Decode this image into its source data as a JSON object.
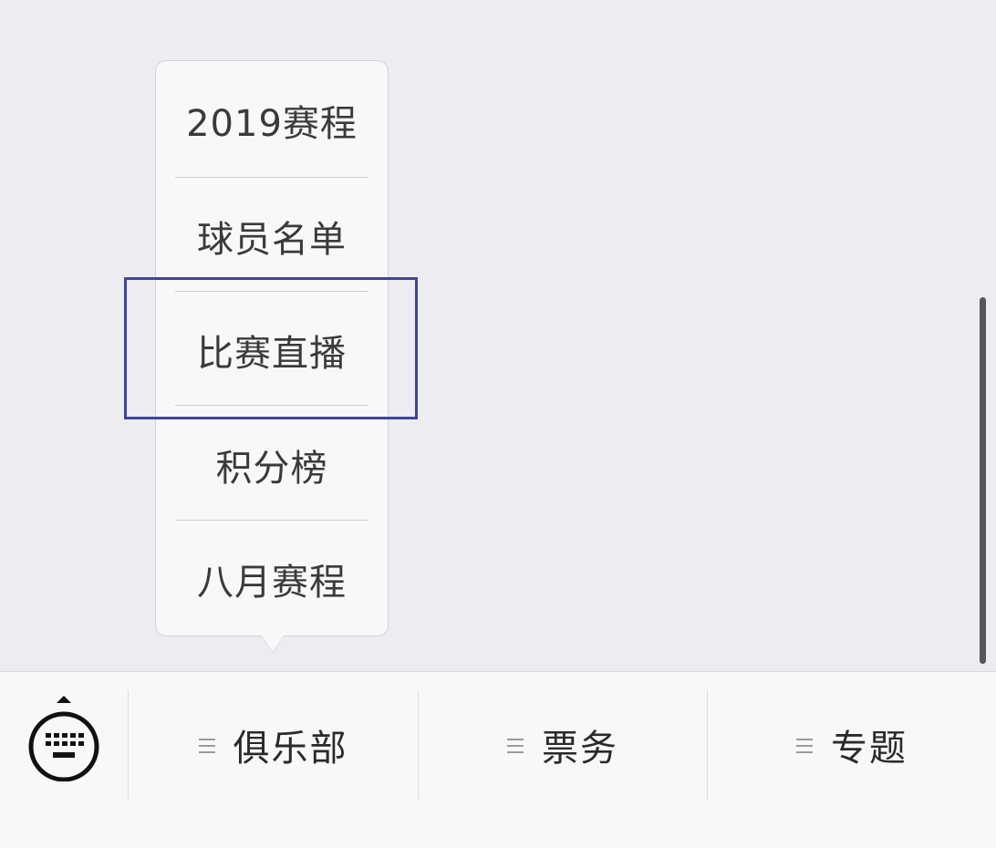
{
  "popup_menu": {
    "items": [
      {
        "label": "2019赛程"
      },
      {
        "label": "球员名单"
      },
      {
        "label": "比赛直播"
      },
      {
        "label": "积分榜"
      },
      {
        "label": "八月赛程"
      }
    ],
    "highlighted_item": "比赛直播"
  },
  "bottom_bar": {
    "keyboard_icon": "keyboard-icon",
    "tabs": [
      {
        "label": "俱乐部",
        "icon": "menu-icon"
      },
      {
        "label": "票务",
        "icon": "menu-icon"
      },
      {
        "label": "专题",
        "icon": "menu-icon"
      }
    ]
  },
  "colors": {
    "background": "#edecf0",
    "popup_background": "#f8f7fa",
    "highlight_border": "#3f4596",
    "text": "#3a3a3a"
  }
}
